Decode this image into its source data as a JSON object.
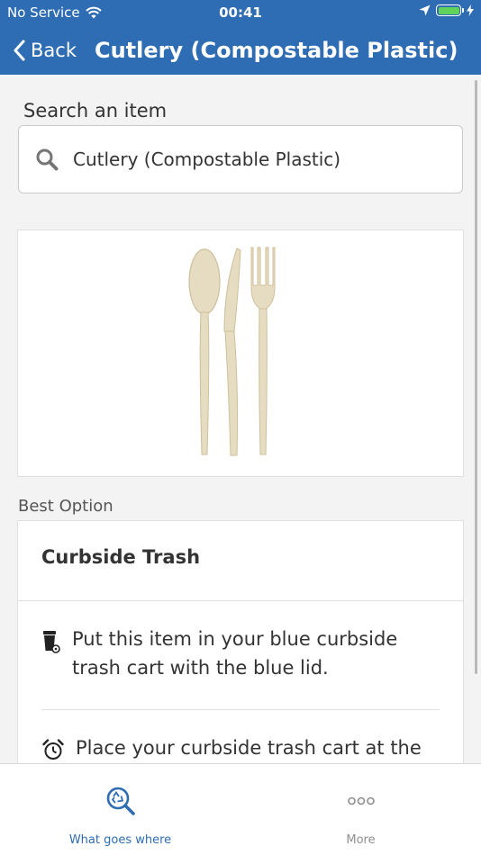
{
  "status_bar": {
    "carrier": "No Service",
    "time": "00:41"
  },
  "nav": {
    "back_label": "Back",
    "title": "Cutlery (Compostable Plastic)"
  },
  "search": {
    "label": "Search an item",
    "value": "Cutlery (Compostable Plastic)",
    "icon": "search-icon"
  },
  "item_image": {
    "subject": "compostable plastic spoon, knife and fork"
  },
  "best_option": {
    "label": "Best Option",
    "title": "Curbside Trash",
    "instructions": [
      {
        "icon": "trash-cart-icon",
        "text": "Put this item in your blue curbside trash cart with the blue lid."
      },
      {
        "icon": "alarm-clock-icon",
        "text": "Place your curbside trash cart at the"
      }
    ]
  },
  "tabs": [
    {
      "label": "What goes where",
      "icon": "recycle-search-icon",
      "active": true
    },
    {
      "label": "More",
      "icon": "more-dots-icon",
      "active": false
    }
  ],
  "colors": {
    "brand_blue": "#2e6db3",
    "active_tab": "#2e6db3",
    "inactive_tab": "#8e8e8e",
    "battery": "#5fd35a"
  }
}
